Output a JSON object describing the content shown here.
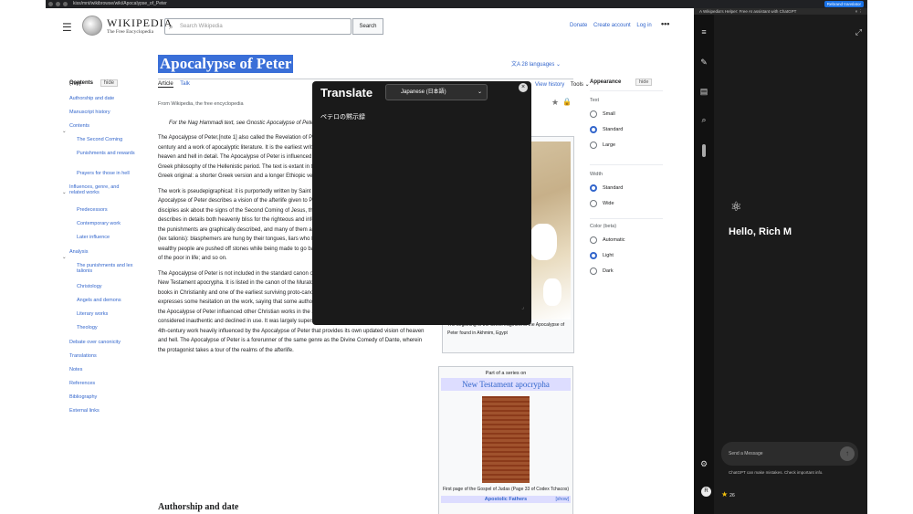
{
  "browser": {
    "url": "kiss/mnt/wikibrowse/wiki/Apocalypse_of_Peter",
    "right_button": "Rebrand translator"
  },
  "wiki": {
    "logo_title": "WIKIPEDIA",
    "logo_subtitle": "The Free Encyclopedia",
    "search_placeholder": "Search Wikipedia",
    "search_button": "Search",
    "top_links": [
      "Donate",
      "Create account",
      "Log in"
    ],
    "page_title": "Apocalypse of Peter",
    "languages": "28 languages",
    "tabs": [
      "Article",
      "Talk"
    ],
    "right_tabs": [
      "Read",
      "Edit",
      "View history",
      "Tools"
    ],
    "tagline": "From Wikipedia, the free encyclopedia",
    "hatnote": "For the Nag Hammadi text, see Gnostic Apocalypse of Peter.",
    "paragraphs": [
      "The Apocalypse of Peter,[note 1] also called the Revelation of Peter, is an early Christian text of the 2nd century and a work of apocalyptic literature. It is the earliest written extant work depicting a Christian account of heaven and hell in detail. The Apocalypse of Peter is influenced by both Jewish apocalyptic literature and Greek philosophy of the Hellenistic period. The text is extant in two main divergent versions, on a lost Koine Greek original: a shorter Greek version and a longer Ethiopic version.",
      "The work is pseudepigraphical: it is purportedly written by Saint Peter, but its actual author is unknown. The Apocalypse of Peter describes a vision of the afterlife given to Peter through the risen Jesus Christ. After the disciples ask about the signs of the Second Coming of Jesus, the work delves into a vision of the afterlife, and describes in details both heavenly bliss for the righteous and infernal punishment for the damned. In particular, the punishments are graphically described, and many of them are said to correspond to \"an eye for an eye\" (lex talionis): blasphemers are hung by their tongues, liars who bear false witness have their lips cut off, and wealthy people are pushed off stones while being made to go barefoot and wear filthy rags, mirroring the status of the poor in life; and so on.",
      "The Apocalypse of Peter is not included in the standard canon of the New Testament, but is classed as part of New Testament apocrypha. It is listed in the canon of the Muratorian fragment, a 2nd-century list of approved books in Christianity and one of the earliest surviving proto-canons. However, the Muratorian fragment expresses some hesitation on the work, saying that some authorities would not have it read in church. While the Apocalypse of Peter influenced other Christian works in the 2nd, 3rd, and 4th centuries, it came to be considered inauthentic and declined in use. It was largely superseded by the Apocalypse of Paul, a popular 4th-century work heavily influenced by the Apocalypse of Peter that provides its own updated vision of heaven and hell. The Apocalypse of Peter is a forerunner of the same genre as the Divine Comedy of Dante, wherein the protagonist takes a tour of the realms of the afterlife."
    ],
    "section_heading": "Authorship and date",
    "contents_title": "Contents",
    "hide_label": "hide",
    "contents": [
      {
        "label": "(Top)",
        "level": 0
      },
      {
        "label": "Authorship and date",
        "level": 0
      },
      {
        "label": "Manuscript history",
        "level": 0
      },
      {
        "label": "Contents",
        "level": 0,
        "toggle": true
      },
      {
        "label": "The Second Coming",
        "level": 1
      },
      {
        "label": "Punishments and rewards",
        "level": 1
      },
      {
        "label": "Prayers for those in hell",
        "level": 1
      },
      {
        "label": "Influences, genre, and related works",
        "level": 0,
        "toggle": true
      },
      {
        "label": "Predecessors",
        "level": 1
      },
      {
        "label": "Contemporary work",
        "level": 1
      },
      {
        "label": "Later influence",
        "level": 1
      },
      {
        "label": "Analysis",
        "level": 0,
        "toggle": true
      },
      {
        "label": "The punishments and lex talionis",
        "level": 1
      },
      {
        "label": "Christology",
        "level": 1
      },
      {
        "label": "Angels and demons",
        "level": 1
      },
      {
        "label": "Literary works",
        "level": 1
      },
      {
        "label": "Theology",
        "level": 1
      },
      {
        "label": "Debate over canonicity",
        "level": 0
      },
      {
        "label": "Translations",
        "level": 0
      },
      {
        "label": "Notes",
        "level": 0
      },
      {
        "label": "References",
        "level": 0
      },
      {
        "label": "Bibliography",
        "level": 0
      },
      {
        "label": "External links",
        "level": 0
      }
    ],
    "infobox_caption": "The beginning of the Greek fragment of the Apocalypse of Peter found in Akhmim, Egypt",
    "series": {
      "part_of": "Part of a series on",
      "title": "New Testament apocrypha",
      "caption": "First page of the Gospel of Judas (Page 33 of Codex Tchacos)",
      "group": "Apostolic Fathers",
      "show": "[show]"
    },
    "appearance": {
      "title": "Appearance",
      "hide": "hide",
      "text_label": "Text",
      "text_options": [
        "Small",
        "Standard",
        "Large"
      ],
      "text_selected": 1,
      "width_label": "Width",
      "width_options": [
        "Standard",
        "Wide"
      ],
      "width_selected": 0,
      "color_label": "Color (beta)",
      "color_options": [
        "Automatic",
        "Light",
        "Dark"
      ],
      "color_selected": 1
    }
  },
  "translate": {
    "title": "Translate",
    "language": "Japanese (日本語)",
    "output": "ペテロの黙示録"
  },
  "chatgpt": {
    "tab_title": "A Wikipedia's Helper: Free AI assistant with ChatGPT",
    "greeting": "Hello, Rich M",
    "message_placeholder": "Send a Message",
    "disclaimer": "ChatGPT can make mistakes. Check important info.",
    "avatar_letter": "R",
    "star_count": "26"
  }
}
